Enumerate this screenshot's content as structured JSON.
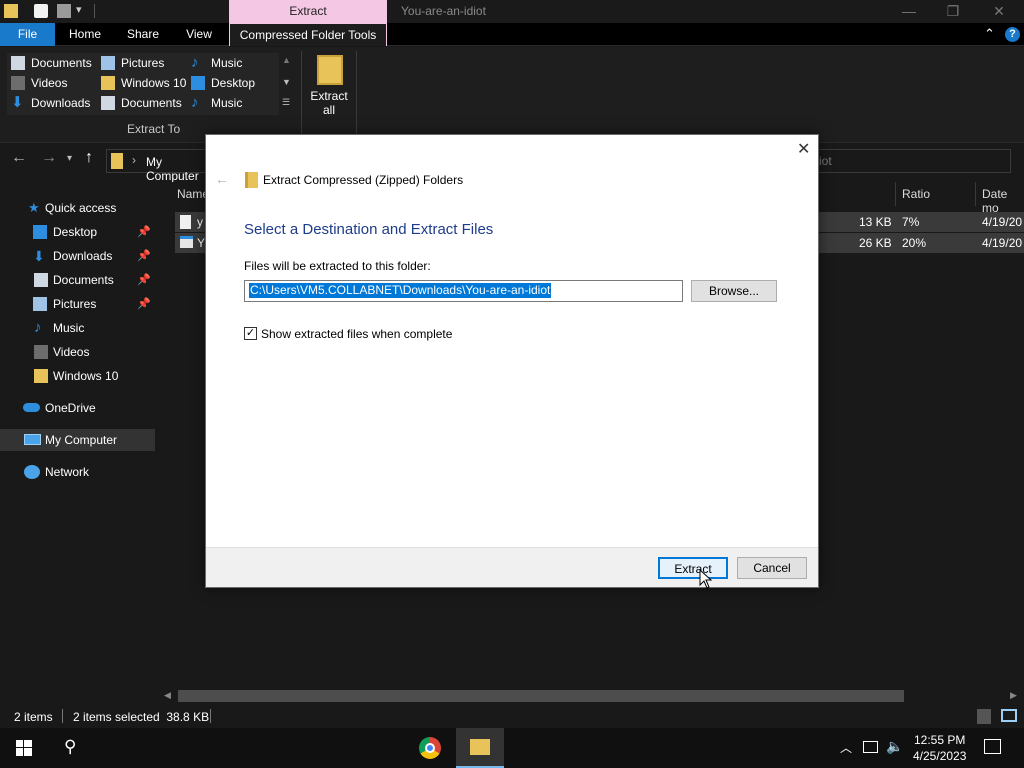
{
  "titlebar": {
    "context_tab": "Extract",
    "window_title": "You-are-an-idiot",
    "minimize": "—",
    "maximize": "❐",
    "close": "✕"
  },
  "ribbon_tabs": {
    "file": "File",
    "home": "Home",
    "share": "Share",
    "view": "View",
    "compressed_tools": "Compressed Folder Tools"
  },
  "ribbon": {
    "col1": [
      "Documents",
      "Videos",
      "Downloads"
    ],
    "col2": [
      "Pictures",
      "Windows 10",
      "Documents"
    ],
    "col3": [
      "Music",
      "Desktop",
      "Music"
    ],
    "group_label": "Extract To",
    "extract_all": "Extract all"
  },
  "address": {
    "crumb": "My Computer",
    "search_tail": "iot"
  },
  "nav": {
    "quick_access": "Quick access",
    "items": [
      "Desktop",
      "Downloads",
      "Documents",
      "Pictures",
      "Music",
      "Videos",
      "Windows 10"
    ],
    "onedrive": "OneDrive",
    "my_computer": "My Computer",
    "network": "Network"
  },
  "files": {
    "col_name": "Name",
    "col_ratio": "Ratio",
    "col_date": "Date mo",
    "rows": [
      {
        "name": "y",
        "size": "13 KB",
        "ratio": "7%",
        "date": "4/19/20"
      },
      {
        "name": "Y",
        "size": "26 KB",
        "ratio": "20%",
        "date": "4/19/20"
      }
    ]
  },
  "status": {
    "items": "2 items",
    "selected": "2 items selected  38.8 KB"
  },
  "taskbar": {
    "time": "12:55 PM",
    "date": "4/25/2023"
  },
  "dialog": {
    "title": "Extract Compressed (Zipped) Folders",
    "heading": "Select a Destination and Extract Files",
    "folder_label": "Files will be extracted to this folder:",
    "path": "C:\\Users\\VM5.COLLABNET\\Downloads\\You-are-an-idiot",
    "browse": "Browse...",
    "show_files_label": "Show extracted files when complete",
    "show_files_checked": true,
    "extract": "Extract",
    "cancel": "Cancel"
  },
  "colors": {
    "accent": "#1979ca",
    "heading": "#1e3c8c",
    "selection": "#0078d7",
    "context_tab": "#f4c7e4"
  }
}
